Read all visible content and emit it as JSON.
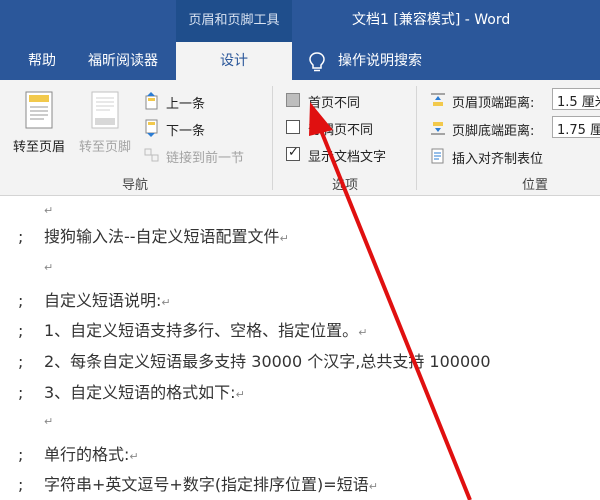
{
  "titlebar": {
    "contextual_label": "页眉和页脚工具",
    "document_title": "文档1 [兼容模式] - Word",
    "color": "#2b579a"
  },
  "tabs": {
    "help": "帮助",
    "foxit": "福昕阅读器",
    "design": "设计",
    "search": "操作说明搜索"
  },
  "ribbon": {
    "nav": {
      "goto_header": "转至页眉",
      "goto_footer": "转至页脚",
      "previous": "上一条",
      "next": "下一条",
      "link_previous": "链接到前一节",
      "group_label": "导航"
    },
    "options": {
      "different_first_page": "首页不同",
      "different_odd_even": "奇偶页不同",
      "show_document_text": "显示文档文字",
      "show_document_text_checked": true,
      "different_first_page_checked": false,
      "different_odd_even_checked": false,
      "group_label": "选项"
    },
    "position": {
      "header_from_top_label": "页眉顶端距离:",
      "header_from_top_value": "1.5 厘米",
      "footer_from_bottom_label": "页脚底端距离:",
      "footer_from_bottom_value": "1.75 厘",
      "insert_alignment_tab": "插入对齐制表位",
      "group_label": "位置"
    }
  },
  "document": {
    "lines": [
      {
        "semi": "",
        "text": ""
      },
      {
        "semi": ";",
        "text": "搜狗输入法--自定义短语配置文件"
      },
      {
        "semi": "",
        "text": ""
      },
      {
        "semi": ";",
        "text": "自定义短语说明:"
      },
      {
        "semi": ";",
        "text": "1、自定义短语支持多行、空格、指定位置。"
      },
      {
        "semi": ";",
        "text": "2、每条自定义短语最多支持 30000 个汉字,总共支持 100000"
      },
      {
        "semi": ";",
        "text": "3、自定义短语的格式如下:"
      },
      {
        "semi": "",
        "text": ""
      },
      {
        "semi": ";",
        "text": "单行的格式:"
      },
      {
        "semi": ";",
        "text": "字符串+英文逗号+数字(指定排序位置)=短语"
      }
    ]
  }
}
